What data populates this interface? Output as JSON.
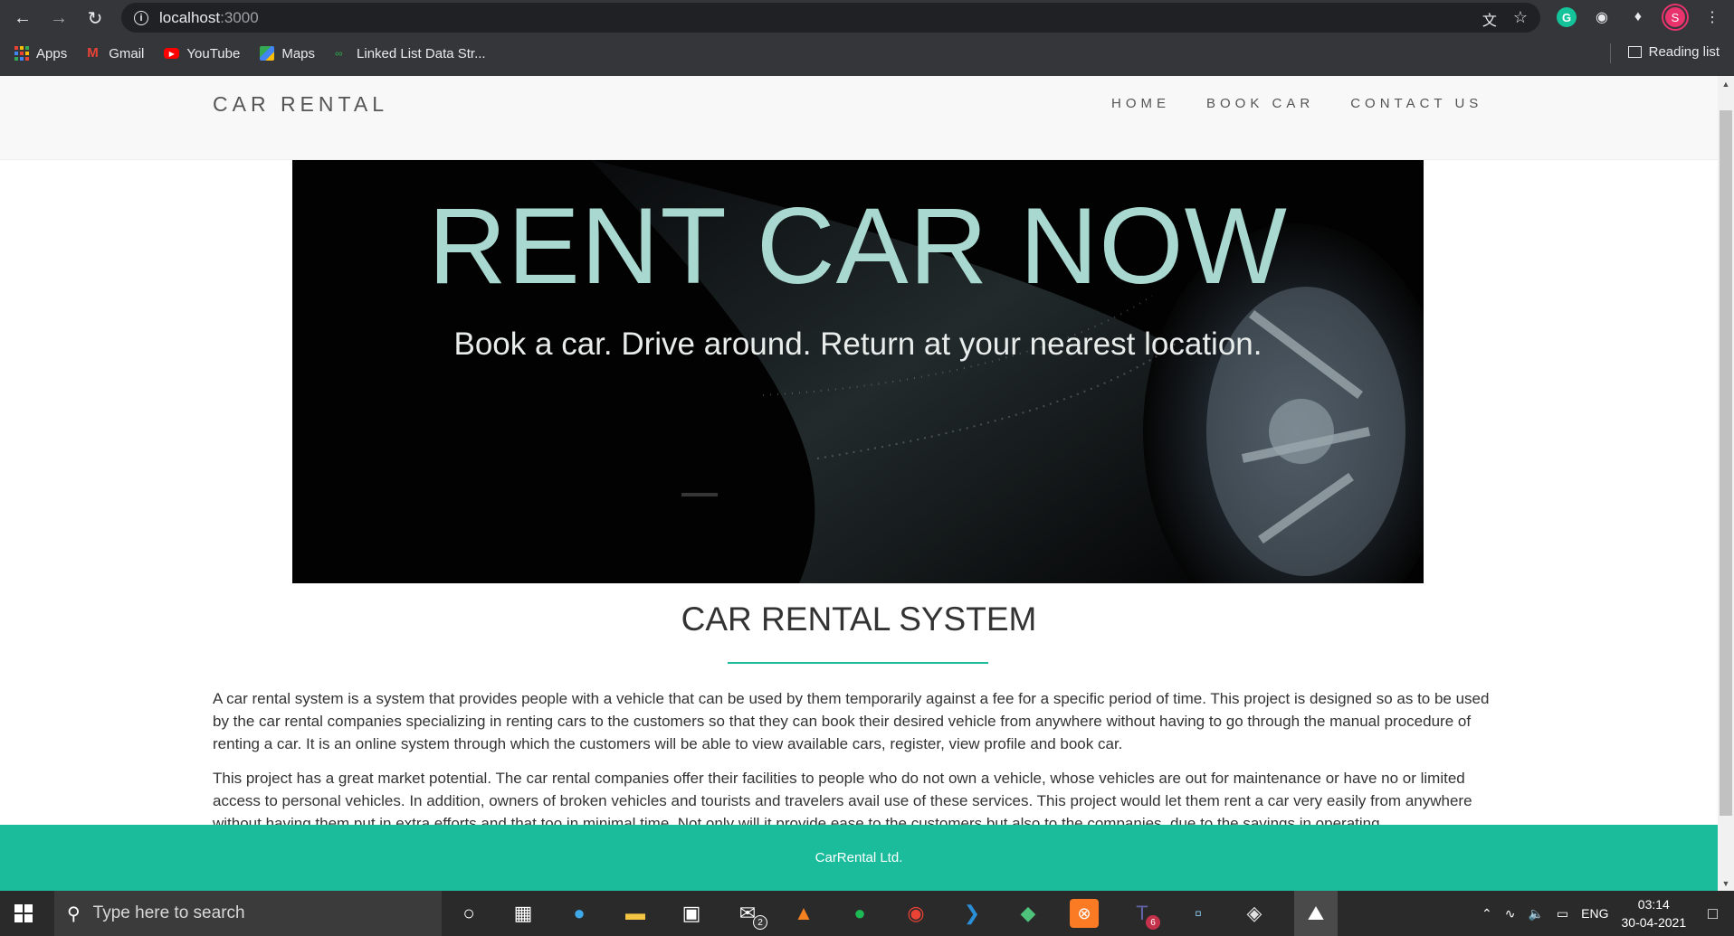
{
  "browser": {
    "url_host": "localhost",
    "url_port": ":3000",
    "bookmarks": [
      "Apps",
      "Gmail",
      "YouTube",
      "Maps",
      "Linked List Data Str..."
    ],
    "reading_list": "Reading list",
    "profile_initial": "S",
    "ext_grammarly": "G"
  },
  "site": {
    "brand": "CAR RENTAL",
    "nav": [
      "HOME",
      "BOOK CAR",
      "CONTACT US"
    ],
    "hero_title": "RENT CAR NOW",
    "hero_subtitle": "Book a car. Drive around. Return at your nearest location.",
    "section_title": "CAR RENTAL SYSTEM",
    "paragraph1": "A car rental system is a system that provides people with a vehicle that can be used by them temporarily against a fee for a specific period of time. This project is designed so as to be used by the car rental companies specializing in renting cars to the customers so that they can book their desired vehicle from anywhere without having to go through the manual procedure of renting a car. It is an online system through which the customers will be able to view available cars, register, view profile and book car.",
    "paragraph2": "This project has a great market potential. The car rental companies offer their facilities to people who do not own a vehicle, whose vehicles are out for maintenance or have no or limited access to personal vehicles. In addition, owners of broken vehicles and tourists and travelers avail use of these services. This project would let them rent a car very easily from anywhere without having them put in extra efforts and that too in minimal time. Not only will it provide ease to the customers but also to the companies, due to the savings in operating",
    "footer": "CarRental Ltd."
  },
  "taskbar": {
    "search_placeholder": "Type here to search",
    "mail_badge": "2",
    "teams_badge": "6",
    "language": "ENG",
    "time": "03:14",
    "date": "30-04-2021"
  },
  "colors": {
    "accent": "#1abc9c",
    "hero_title": "#a8d8cf",
    "browser_chrome": "#35363a"
  }
}
